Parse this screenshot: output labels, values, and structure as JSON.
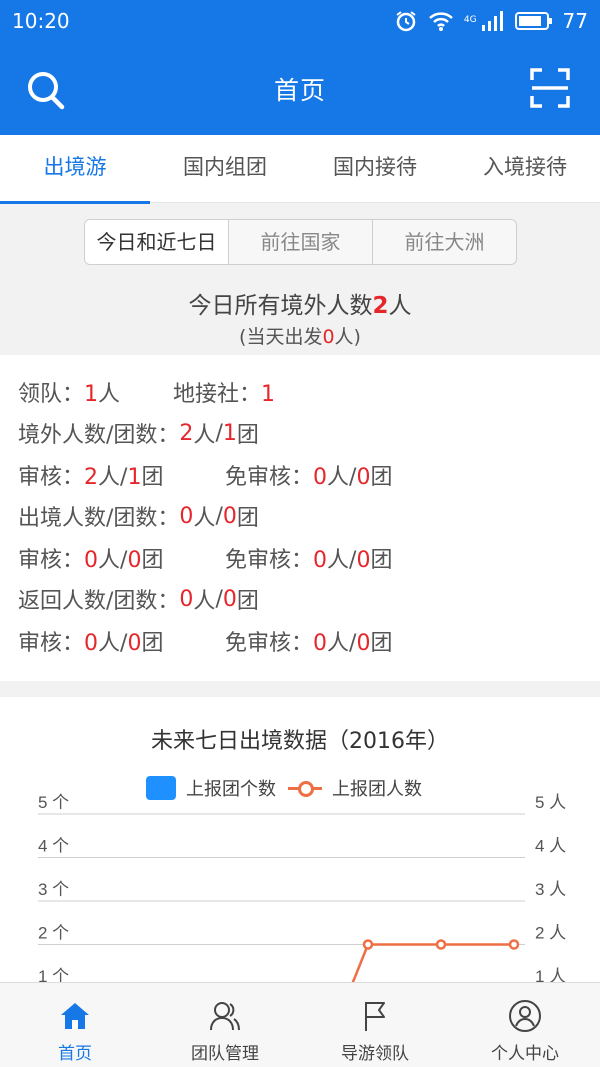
{
  "status_bar": {
    "time": "10:20",
    "battery": "77",
    "network": "4G"
  },
  "header": {
    "title": "首页",
    "left_icon": "search-icon",
    "right_icon": "scan-icon"
  },
  "tabs": [
    {
      "label": "出境游",
      "active": true
    },
    {
      "label": "国内组团",
      "active": false
    },
    {
      "label": "国内接待",
      "active": false
    },
    {
      "label": "入境接待",
      "active": false
    }
  ],
  "segments": [
    "今日和近七日",
    "前往国家",
    "前往大洲"
  ],
  "summary": {
    "prefix": "今日所有境外人数",
    "count": "2",
    "suffix": "人",
    "sub_prefix": "(当天出发",
    "sub_count": "0",
    "sub_suffix": "人)"
  },
  "stats": {
    "leader_label": "领队：",
    "leader_value": "1",
    "leader_unit": "人",
    "agency_label": "地接社：",
    "agency_value": "1",
    "abroad_label": "境外人数/团数：",
    "abroad_people": "2",
    "abroad_groups": "1",
    "abroad_audit_people": "2",
    "abroad_audit_groups": "1",
    "abroad_exempt_people": "0",
    "abroad_exempt_groups": "0",
    "exit_label": "出境人数/团数：",
    "exit_people": "0",
    "exit_groups": "0",
    "exit_audit_people": "0",
    "exit_audit_groups": "0",
    "exit_exempt_people": "0",
    "exit_exempt_groups": "0",
    "return_label": "返回人数/团数：",
    "return_people": "0",
    "return_groups": "0",
    "return_audit_people": "0",
    "return_audit_groups": "0",
    "return_exempt_people": "0",
    "return_exempt_groups": "0",
    "audit_label": "审核：",
    "exempt_label": "免审核：",
    "unit_people": "人",
    "unit_group": "团",
    "slash": "/"
  },
  "chart_data": {
    "type": "line",
    "title": "未来七日出境数据（2016年）",
    "legend": [
      "上报团个数",
      "上报团人数"
    ],
    "legend_placement": "top",
    "y_left_ticks": [
      "5 个",
      "4 个",
      "3 个",
      "2 个",
      "1 个"
    ],
    "y_right_ticks": [
      "5 人",
      "4 人",
      "3 人",
      "2 人",
      "1 人"
    ],
    "ylim": [
      0,
      5
    ],
    "series": [
      {
        "name": "上报团人数",
        "visible_points": [
          2,
          2,
          2
        ],
        "color": "#ef6f45"
      }
    ],
    "colors": {
      "groups": "#1e90ff",
      "people": "#ef6f45"
    }
  },
  "bottom_nav": [
    {
      "label": "首页",
      "icon": "home-icon",
      "active": true
    },
    {
      "label": "团队管理",
      "icon": "team-icon",
      "active": false
    },
    {
      "label": "导游领队",
      "icon": "flag-icon",
      "active": false
    },
    {
      "label": "个人中心",
      "icon": "user-icon",
      "active": false
    }
  ],
  "colors": {
    "primary": "#1677e6",
    "highlight": "#e5262b"
  }
}
